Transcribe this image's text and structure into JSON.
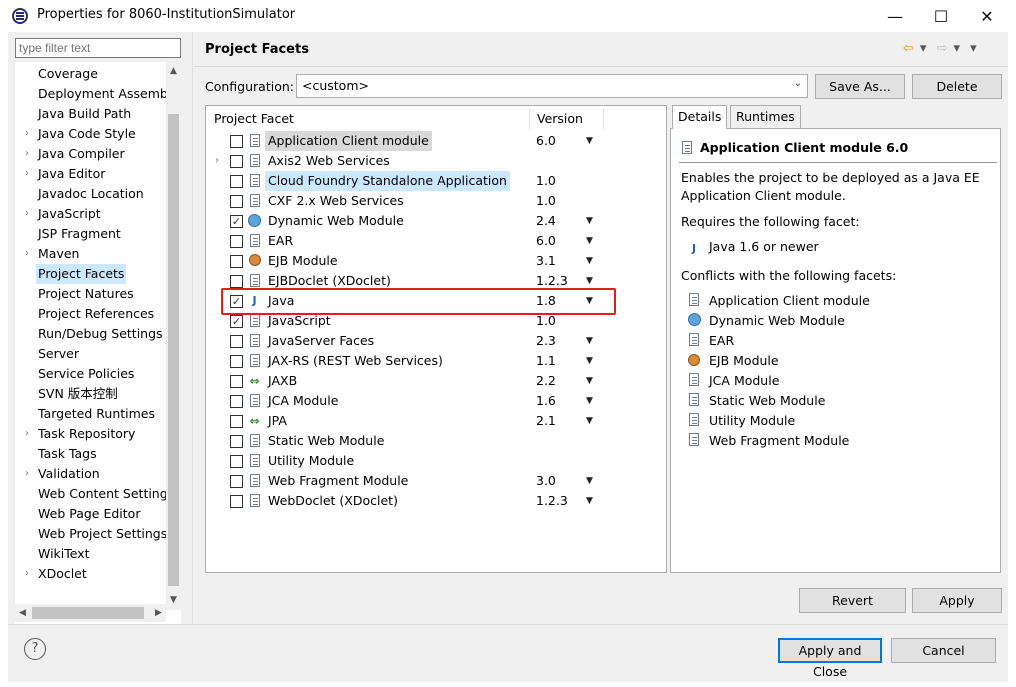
{
  "window": {
    "title": "Properties for 8060-InstitutionSimulator",
    "minimize": "—",
    "maximize": "☐",
    "close": "✕"
  },
  "nav": {
    "filter_placeholder": "type filter text",
    "items": [
      {
        "label": "Coverage",
        "expandable": false
      },
      {
        "label": "Deployment Assembly",
        "expandable": false
      },
      {
        "label": "Java Build Path",
        "expandable": false
      },
      {
        "label": "Java Code Style",
        "expandable": true
      },
      {
        "label": "Java Compiler",
        "expandable": true
      },
      {
        "label": "Java Editor",
        "expandable": true
      },
      {
        "label": "Javadoc Location",
        "expandable": false
      },
      {
        "label": "JavaScript",
        "expandable": true
      },
      {
        "label": "JSP Fragment",
        "expandable": false
      },
      {
        "label": "Maven",
        "expandable": true
      },
      {
        "label": "Project Facets",
        "expandable": false,
        "selected": true
      },
      {
        "label": "Project Natures",
        "expandable": false
      },
      {
        "label": "Project References",
        "expandable": false
      },
      {
        "label": "Run/Debug Settings",
        "expandable": false
      },
      {
        "label": "Server",
        "expandable": false
      },
      {
        "label": "Service Policies",
        "expandable": false
      },
      {
        "label": "SVN 版本控制",
        "expandable": false
      },
      {
        "label": "Targeted Runtimes",
        "expandable": false
      },
      {
        "label": "Task Repository",
        "expandable": true
      },
      {
        "label": "Task Tags",
        "expandable": false
      },
      {
        "label": "Validation",
        "expandable": true
      },
      {
        "label": "Web Content Settings",
        "expandable": false
      },
      {
        "label": "Web Page Editor",
        "expandable": false
      },
      {
        "label": "Web Project Settings",
        "expandable": false
      },
      {
        "label": "WikiText",
        "expandable": false
      },
      {
        "label": "XDoclet",
        "expandable": true
      }
    ]
  },
  "page": {
    "title": "Project Facets",
    "nav_back": "⇦",
    "nav_forward": "⇨",
    "menu": "▾"
  },
  "configuration": {
    "label": "Configuration:",
    "value": "<custom>",
    "save_as": "Save As...",
    "delete": "Delete"
  },
  "facets": {
    "col_facet": "Project Facet",
    "col_version": "Version",
    "rows": [
      {
        "name": "Application Client module",
        "version": "6.0",
        "checked": false,
        "dropdown": true,
        "icon": "page",
        "style": "hl"
      },
      {
        "name": "Axis2 Web Services",
        "version": "",
        "checked": false,
        "dropdown": false,
        "icon": "page",
        "expandable": true
      },
      {
        "name": "Cloud Foundry Standalone Application",
        "version": "1.0",
        "checked": false,
        "dropdown": false,
        "icon": "page",
        "style": "hl2"
      },
      {
        "name": "CXF 2.x Web Services",
        "version": "1.0",
        "checked": false,
        "dropdown": false,
        "icon": "page"
      },
      {
        "name": "Dynamic Web Module",
        "version": "2.4",
        "checked": true,
        "dropdown": true,
        "icon": "globe"
      },
      {
        "name": "EAR",
        "version": "6.0",
        "checked": false,
        "dropdown": true,
        "icon": "page"
      },
      {
        "name": "EJB Module",
        "version": "3.1",
        "checked": false,
        "dropdown": true,
        "icon": "bean"
      },
      {
        "name": "EJBDoclet (XDoclet)",
        "version": "1.2.3",
        "checked": false,
        "dropdown": true,
        "icon": "page"
      },
      {
        "name": "Java",
        "version": "1.8",
        "checked": true,
        "dropdown": true,
        "icon": "java"
      },
      {
        "name": "JavaScript",
        "version": "1.0",
        "checked": true,
        "dropdown": false,
        "icon": "page"
      },
      {
        "name": "JavaServer Faces",
        "version": "2.3",
        "checked": false,
        "dropdown": true,
        "icon": "page"
      },
      {
        "name": "JAX-RS (REST Web Services)",
        "version": "1.1",
        "checked": false,
        "dropdown": true,
        "icon": "page"
      },
      {
        "name": "JAXB",
        "version": "2.2",
        "checked": false,
        "dropdown": true,
        "icon": "xchg"
      },
      {
        "name": "JCA Module",
        "version": "1.6",
        "checked": false,
        "dropdown": true,
        "icon": "page"
      },
      {
        "name": "JPA",
        "version": "2.1",
        "checked": false,
        "dropdown": true,
        "icon": "xchg"
      },
      {
        "name": "Static Web Module",
        "version": "",
        "checked": false,
        "dropdown": false,
        "icon": "page"
      },
      {
        "name": "Utility Module",
        "version": "",
        "checked": false,
        "dropdown": false,
        "icon": "page"
      },
      {
        "name": "Web Fragment Module",
        "version": "3.0",
        "checked": false,
        "dropdown": true,
        "icon": "page"
      },
      {
        "name": "WebDoclet (XDoclet)",
        "version": "1.2.3",
        "checked": false,
        "dropdown": true,
        "icon": "page"
      }
    ]
  },
  "details": {
    "tab_details": "Details",
    "tab_runtimes": "Runtimes",
    "title": "Application Client module 6.0",
    "description_1": "Enables the project to be deployed as a Java EE",
    "description_2": "Application Client module.",
    "requires_label": "Requires the following facet:",
    "requires": [
      {
        "name": "Java 1.6 or newer",
        "icon": "java"
      }
    ],
    "conflicts_label": "Conflicts with the following facets:",
    "conflicts": [
      {
        "name": "Application Client module",
        "icon": "page"
      },
      {
        "name": "Dynamic Web Module",
        "icon": "globe"
      },
      {
        "name": "EAR",
        "icon": "page"
      },
      {
        "name": "EJB Module",
        "icon": "bean"
      },
      {
        "name": "JCA Module",
        "icon": "page"
      },
      {
        "name": "Static Web Module",
        "icon": "page"
      },
      {
        "name": "Utility Module",
        "icon": "page"
      },
      {
        "name": "Web Fragment Module",
        "icon": "page"
      }
    ]
  },
  "buttons": {
    "revert": "Revert",
    "apply": "Apply",
    "apply_close": "Apply and Close",
    "cancel": "Cancel",
    "help": "?"
  }
}
